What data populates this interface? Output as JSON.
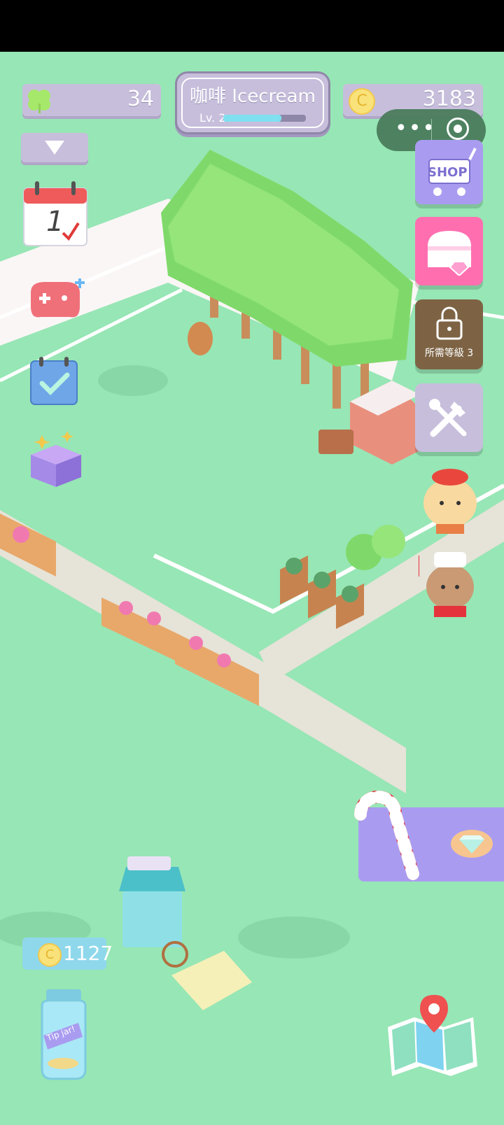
{
  "hud": {
    "clover_count": "34",
    "title": "咖啡 Icecream",
    "level": "Lv. 2",
    "level_progress": 0.7,
    "coins": "3183",
    "coin_symbol": "C"
  },
  "sidebar_right": {
    "shop_label": "SHOP",
    "locked_label": "所需等級 3"
  },
  "calendar": {
    "day": "1"
  },
  "tip_jar": {
    "coins": "1127",
    "label": "Tip jar!"
  },
  "colors": {
    "grass": "#97e6b5",
    "purple": "#a99cf0",
    "pink": "#ff6fb0",
    "lavender": "#c7bedc"
  },
  "icons": [
    "clover-icon",
    "coin-icon",
    "dropdown-icon",
    "calendar-icon",
    "gamepad-icon",
    "checklist-icon",
    "gift-box-icon",
    "shop-icon",
    "treasure-chest-icon",
    "lock-icon",
    "tools-icon",
    "map-icon",
    "diamond-icon",
    "candy-cane-icon",
    "tip-jar-icon"
  ]
}
